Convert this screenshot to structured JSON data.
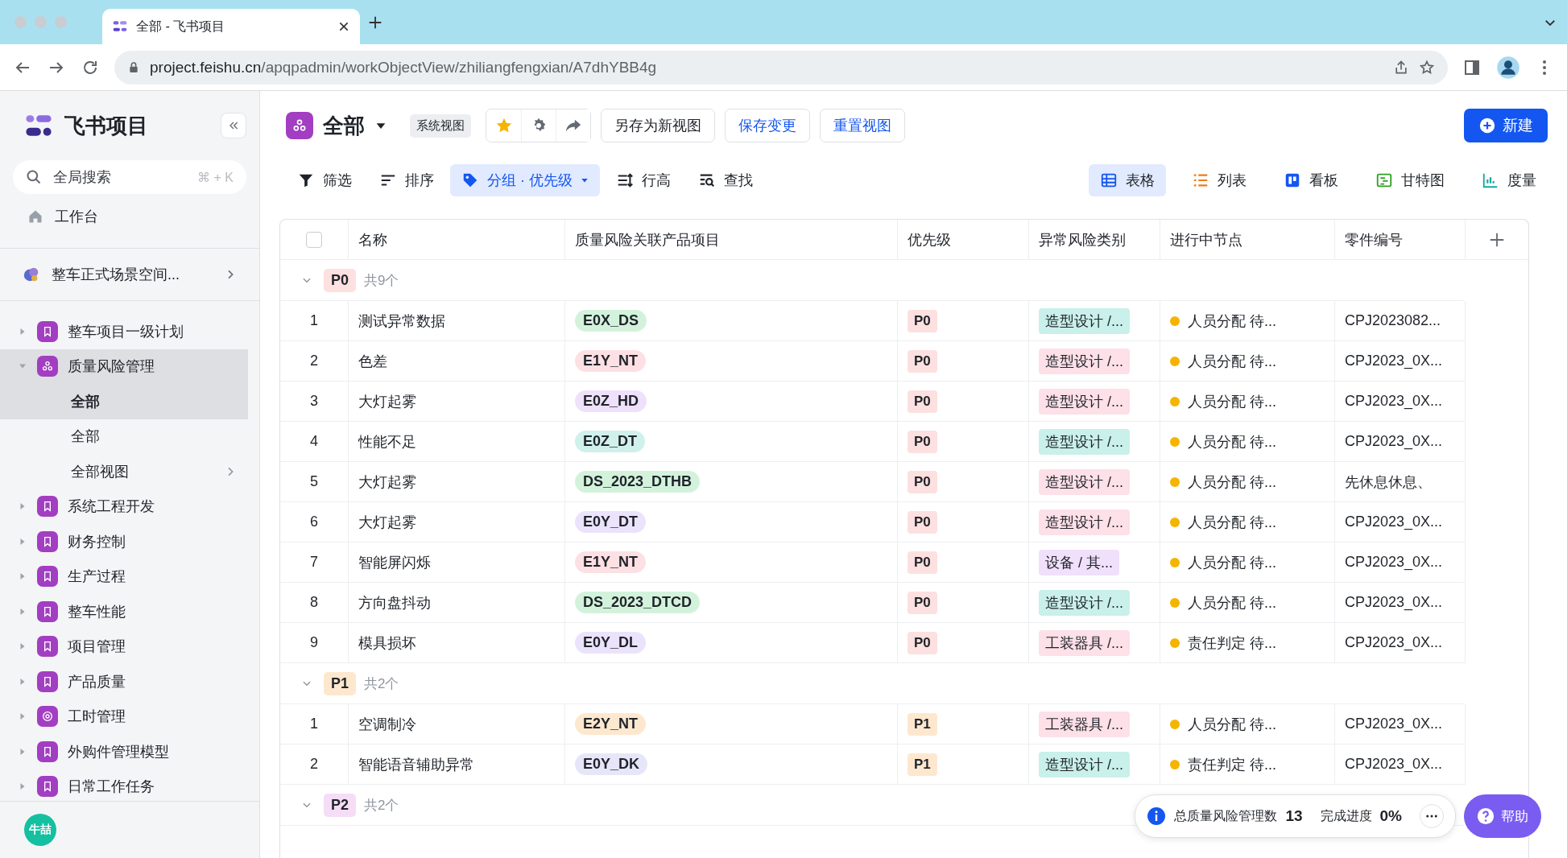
{
  "browser": {
    "tab_title": "全部 - 飞书项目",
    "url_host": "project.feishu.cn",
    "url_path": "/apqpadmin/workObjectView/zhiliangfengxian/A7dhYBB4g"
  },
  "sidebar": {
    "brand": "飞书项目",
    "search": {
      "placeholder": "全局搜索",
      "shortcut": "⌘ + K"
    },
    "workbench": "工作台",
    "space": "整车正式场景空间...",
    "projects": [
      {
        "label": "整车项目一级计划",
        "kind": "bookmark",
        "expanded": false,
        "selected": false
      },
      {
        "label": "质量风险管理",
        "kind": "cycle",
        "expanded": true,
        "selected": true,
        "children": [
          {
            "label": "全部",
            "selected": true,
            "submenu": false
          },
          {
            "label": "全部",
            "selected": false,
            "submenu": false
          },
          {
            "label": "全部视图",
            "selected": false,
            "submenu": true
          }
        ]
      },
      {
        "label": "系统工程开发",
        "kind": "bookmark",
        "expanded": false,
        "selected": false
      },
      {
        "label": "财务控制",
        "kind": "bookmark",
        "expanded": false,
        "selected": false
      },
      {
        "label": "生产过程",
        "kind": "bookmark",
        "expanded": false,
        "selected": false
      },
      {
        "label": "整车性能",
        "kind": "bookmark",
        "expanded": false,
        "selected": false
      },
      {
        "label": "项目管理",
        "kind": "bookmark",
        "expanded": false,
        "selected": false
      },
      {
        "label": "产品质量",
        "kind": "bookmark",
        "expanded": false,
        "selected": false
      },
      {
        "label": "工时管理",
        "kind": "clock",
        "expanded": false,
        "selected": false
      },
      {
        "label": "外购件管理模型",
        "kind": "bookmark",
        "expanded": false,
        "selected": false
      },
      {
        "label": "日常工作任务",
        "kind": "bookmark",
        "expanded": false,
        "selected": false
      }
    ],
    "avatar": "牛喆"
  },
  "header": {
    "title": "全部",
    "badge": "系统视图",
    "buttons": [
      {
        "label": "另存为新视图",
        "kind": "plain"
      },
      {
        "label": "保存变更",
        "kind": "accent"
      },
      {
        "label": "重置视图",
        "kind": "accent"
      }
    ],
    "new_button": "新建"
  },
  "toolbar": {
    "tools": [
      {
        "label": "筛选",
        "selected": false
      },
      {
        "label": "排序",
        "selected": false
      },
      {
        "label": "分组 · 优先级",
        "selected": true
      },
      {
        "label": "行高",
        "selected": false
      },
      {
        "label": "查找",
        "selected": false
      }
    ],
    "views": [
      {
        "label": "表格",
        "selected": true
      },
      {
        "label": "列表",
        "selected": false
      },
      {
        "label": "看板",
        "selected": false
      },
      {
        "label": "甘特图",
        "selected": false
      },
      {
        "label": "度量",
        "selected": false
      }
    ]
  },
  "table": {
    "select_all_checked": false,
    "columns": [
      "名称",
      "质量风险关联产品项目",
      "优先级",
      "异常风险类别",
      "进行中节点",
      "零件编号"
    ],
    "groups": [
      {
        "label": "P0",
        "count": "共9个",
        "color": "#fde0e0",
        "expanded": true,
        "rows": [
          {
            "index": "1",
            "name": "测试异常数据",
            "product": {
              "text": "E0X_DS",
              "color": "#d3f2dc"
            },
            "priority": {
              "text": "P0",
              "color": "#fde0e0"
            },
            "category": {
              "text": "造型设计 /...",
              "color": "#c9f0ea"
            },
            "node": {
              "text": "人员分配 待...",
              "color": "#f5b400"
            },
            "part": "CPJ2023082..."
          },
          {
            "index": "2",
            "name": "色差",
            "product": {
              "text": "E1Y_NT",
              "color": "#fde0e4"
            },
            "priority": {
              "text": "P0",
              "color": "#fde0e0"
            },
            "category": {
              "text": "造型设计 /...",
              "color": "#fde0e8"
            },
            "node": {
              "text": "人员分配 待...",
              "color": "#f5b400"
            },
            "part": "CPJ2023_0X..."
          },
          {
            "index": "3",
            "name": "大灯起雾",
            "product": {
              "text": "E0Z_HD",
              "color": "#efe0fb"
            },
            "priority": {
              "text": "P0",
              "color": "#fde0e0"
            },
            "category": {
              "text": "造型设计 /...",
              "color": "#fde0e8"
            },
            "node": {
              "text": "人员分配 待...",
              "color": "#f5b400"
            },
            "part": "CPJ2023_0X..."
          },
          {
            "index": "4",
            "name": "性能不足",
            "product": {
              "text": "E0Z_DT",
              "color": "#d0f0ec"
            },
            "priority": {
              "text": "P0",
              "color": "#fde0e0"
            },
            "category": {
              "text": "造型设计 /...",
              "color": "#c9f0ea"
            },
            "node": {
              "text": "人员分配 待...",
              "color": "#f5b400"
            },
            "part": "CPJ2023_0X..."
          },
          {
            "index": "5",
            "name": "大灯起雾",
            "product": {
              "text": "DS_2023_DTHB",
              "color": "#d3f2dc"
            },
            "priority": {
              "text": "P0",
              "color": "#fde0e0"
            },
            "category": {
              "text": "造型设计 /...",
              "color": "#fde0e8"
            },
            "node": {
              "text": "人员分配 待...",
              "color": "#f5b400"
            },
            "part": "先休息休息、"
          },
          {
            "index": "6",
            "name": "大灯起雾",
            "product": {
              "text": "E0Y_DT",
              "color": "#ebe3fb"
            },
            "priority": {
              "text": "P0",
              "color": "#fde0e0"
            },
            "category": {
              "text": "造型设计 /...",
              "color": "#fde0e8"
            },
            "node": {
              "text": "人员分配 待...",
              "color": "#f5b400"
            },
            "part": "CPJ2023_0X..."
          },
          {
            "index": "7",
            "name": "智能屏闪烁",
            "product": {
              "text": "E1Y_NT",
              "color": "#fde0e4"
            },
            "priority": {
              "text": "P0",
              "color": "#fde0e0"
            },
            "category": {
              "text": "设备 / 其...",
              "color": "#f0e0fb"
            },
            "node": {
              "text": "人员分配 待...",
              "color": "#f5b400"
            },
            "part": "CPJ2023_0X..."
          },
          {
            "index": "8",
            "name": "方向盘抖动",
            "product": {
              "text": "DS_2023_DTCD",
              "color": "#d3f2dc"
            },
            "priority": {
              "text": "P0",
              "color": "#fde0e0"
            },
            "category": {
              "text": "造型设计 /...",
              "color": "#c9f0ea"
            },
            "node": {
              "text": "人员分配 待...",
              "color": "#f5b400"
            },
            "part": "CPJ2023_0X..."
          },
          {
            "index": "9",
            "name": "模具损坏",
            "product": {
              "text": "E0Y_DL",
              "color": "#ebe3fb"
            },
            "priority": {
              "text": "P0",
              "color": "#fde0e0"
            },
            "category": {
              "text": "工装器具 /...",
              "color": "#fde0e8"
            },
            "node": {
              "text": "责任判定 待...",
              "color": "#f5b400"
            },
            "part": "CPJ2023_0X..."
          }
        ]
      },
      {
        "label": "P1",
        "count": "共2个",
        "color": "#fde8cf",
        "expanded": true,
        "rows": [
          {
            "index": "1",
            "name": "空调制冷",
            "product": {
              "text": "E2Y_NT",
              "color": "#fde8cf"
            },
            "priority": {
              "text": "P1",
              "color": "#fde8cf"
            },
            "category": {
              "text": "工装器具 /...",
              "color": "#fde0e8"
            },
            "node": {
              "text": "人员分配 待...",
              "color": "#f5b400"
            },
            "part": "CPJ2023_0X..."
          },
          {
            "index": "2",
            "name": "智能语音辅助异常",
            "product": {
              "text": "E0Y_DK",
              "color": "#e6e6f8"
            },
            "priority": {
              "text": "P1",
              "color": "#fde8cf"
            },
            "category": {
              "text": "造型设计 /...",
              "color": "#c9f0ea"
            },
            "node": {
              "text": "责任判定 待...",
              "color": "#f5b400"
            },
            "part": "CPJ2023_0X..."
          }
        ]
      },
      {
        "label": "P2",
        "count": "共2个",
        "color": "#f5dcf7",
        "expanded": true
      }
    ]
  },
  "summary": {
    "label": "总质量风险管理数",
    "count": "13",
    "progress_label": "完成进度",
    "progress": "0%"
  },
  "help": "帮助"
}
